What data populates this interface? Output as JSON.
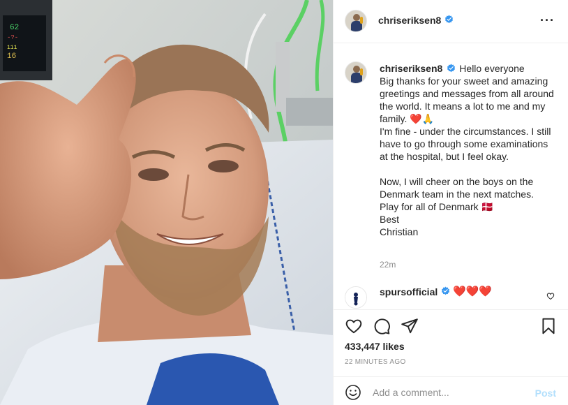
{
  "post": {
    "author": {
      "username": "chriseriksen8",
      "verified": true
    },
    "more_icon": "more-horizontal-icon",
    "caption": {
      "username": "chriseriksen8",
      "lines": [
        "Hello everyone",
        "Big thanks for your sweet and amazing greetings and messages from all around the world. It means a lot to me and my family.",
        "I'm fine - under the circumstances. I still have to go through some examinations at the hospital, but I feel okay.",
        "Now, I will cheer on the boys on the Denmark team in the next matches.",
        "Play for all of Denmark",
        "Best",
        "Christian"
      ],
      "emoji_family": "❤️🙏",
      "emoji_flag": "🇩🇰",
      "time_ago": "22m"
    },
    "comment": {
      "username": "spursofficial",
      "verified": true,
      "text": "❤️❤️❤️"
    },
    "likes": "433,447 likes",
    "posted_time": "22 MINUTES AGO",
    "comment_bar": {
      "placeholder": "Add a comment...",
      "post_label": "Post"
    }
  },
  "colors": {
    "verified_blue": "#3897f0",
    "heart_red": "#e0245e",
    "post_disabled": "#b2dffc",
    "muted_text": "#8e8e8e"
  }
}
